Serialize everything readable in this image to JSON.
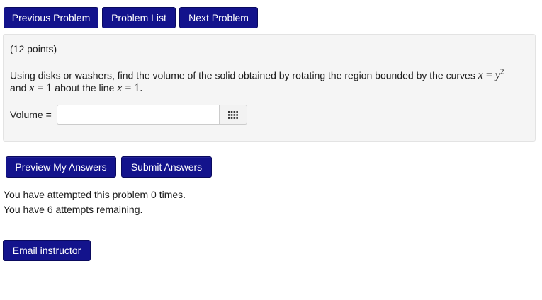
{
  "nav": {
    "previous_label": "Previous Problem",
    "list_label": "Problem List",
    "next_label": "Next Problem"
  },
  "problem": {
    "points": "(12 points)",
    "statement_part1": "Using disks or washers, find the volume of the solid obtained by rotating the region bounded by the curves",
    "statement_and": "and",
    "statement_about": "about the line",
    "math_eq1_lhs": "x",
    "math_eq1_rhs_base": "y",
    "math_eq1_rhs_exp": "2",
    "math_eq2_lhs": "x",
    "math_eq2_rhs": "1",
    "math_eq3_lhs": "x",
    "math_eq3_rhs": "1.",
    "math_equals": "="
  },
  "answer": {
    "label": "Volume =",
    "value": "",
    "placeholder": "",
    "math_button_icon": "grid-icon"
  },
  "actions": {
    "preview_label": "Preview My Answers",
    "submit_label": "Submit Answers"
  },
  "status": {
    "attempted": "You have attempted this problem 0 times.",
    "remaining": "You have 6 attempts remaining."
  },
  "footer": {
    "email_label": "Email instructor"
  },
  "colors": {
    "button_bg": "#13138c",
    "panel_bg": "#f5f5f5"
  }
}
